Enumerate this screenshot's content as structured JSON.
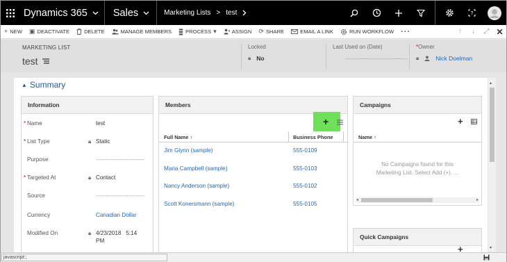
{
  "nav": {
    "app_name": "Dynamics 365",
    "area": "Sales",
    "breadcrumb_section": "Marketing Lists",
    "breadcrumb_record": "test",
    "breadcrumb_separator": ">"
  },
  "commands": [
    {
      "label": "NEW",
      "icon": "plus-icon",
      "glyph": "+"
    },
    {
      "label": "DEACTIVATE",
      "icon": "deactivate-icon",
      "glyph": "▣"
    },
    {
      "label": "DELETE",
      "icon": "trash-icon",
      "glyph": "🗑"
    },
    {
      "label": "MANAGE MEMBERS",
      "icon": "people-icon",
      "glyph": "👥"
    },
    {
      "label": "PROCESS",
      "icon": "process-icon",
      "glyph": "⌗"
    },
    {
      "label": "ASSIGN",
      "icon": "assign-icon",
      "glyph": "👤"
    },
    {
      "label": "SHARE",
      "icon": "share-icon",
      "glyph": "⟳"
    },
    {
      "label": "EMAIL A LINK",
      "icon": "email-icon",
      "glyph": "✉"
    },
    {
      "label": "RUN WORKFLOW",
      "icon": "workflow-icon",
      "glyph": "⚙"
    }
  ],
  "header": {
    "entity_type": "MARKETING LIST",
    "record_name": "test",
    "locked_label": "Locked",
    "locked_value": "No",
    "last_used_label": "Last Used on (Date)",
    "last_used_value": "--------------------------------",
    "owner_label": "Owner",
    "owner_value": "Nick Doelman"
  },
  "summary_title": "Summary",
  "information": {
    "title": "Information",
    "fields": [
      {
        "label": "Name",
        "value": "test",
        "required": true,
        "locked": false,
        "style": "text"
      },
      {
        "label": "List Type",
        "value": "Static",
        "required": true,
        "locked": true,
        "style": "text"
      },
      {
        "label": "Purpose",
        "value": "--------------------------",
        "required": false,
        "locked": false,
        "style": "dash"
      },
      {
        "label": "Targeted At",
        "value": "Contact",
        "required": true,
        "locked": true,
        "style": "text"
      },
      {
        "label": "Source",
        "value": "--------------------------",
        "required": false,
        "locked": false,
        "style": "dash"
      },
      {
        "label": "Currency",
        "value": "Canadian Dollar",
        "required": false,
        "locked": false,
        "style": "link"
      },
      {
        "label": "Modified On",
        "value": "4/23/2018   5:14",
        "value2": "PM",
        "required": false,
        "locked": true,
        "style": "text"
      }
    ]
  },
  "members": {
    "title": "Members",
    "col_name": "Full Name ↑",
    "col_phone": "Business Phone",
    "rows": [
      {
        "name": "Jim Glynn (sample)",
        "phone": "555-0109"
      },
      {
        "name": "Maria Campbell (sample)",
        "phone": "555-0103"
      },
      {
        "name": "Nancy Anderson (sample)",
        "phone": "555-0102"
      },
      {
        "name": "Scott Konersmann (sample)",
        "phone": "555-0105"
      }
    ]
  },
  "campaigns": {
    "title": "Campaigns",
    "col_name": "Name ↑",
    "empty_line1": "No Campaigns found for this",
    "empty_line2": "Marketing List. Select Add (+).  ..."
  },
  "quick_campaigns": {
    "title": "Quick Campaigns"
  },
  "status_text": "javascript:;",
  "colors": {
    "link": "#2468b0",
    "highlight": "#6ee05a",
    "nav_bg": "#000000",
    "required": "#cc0000"
  }
}
